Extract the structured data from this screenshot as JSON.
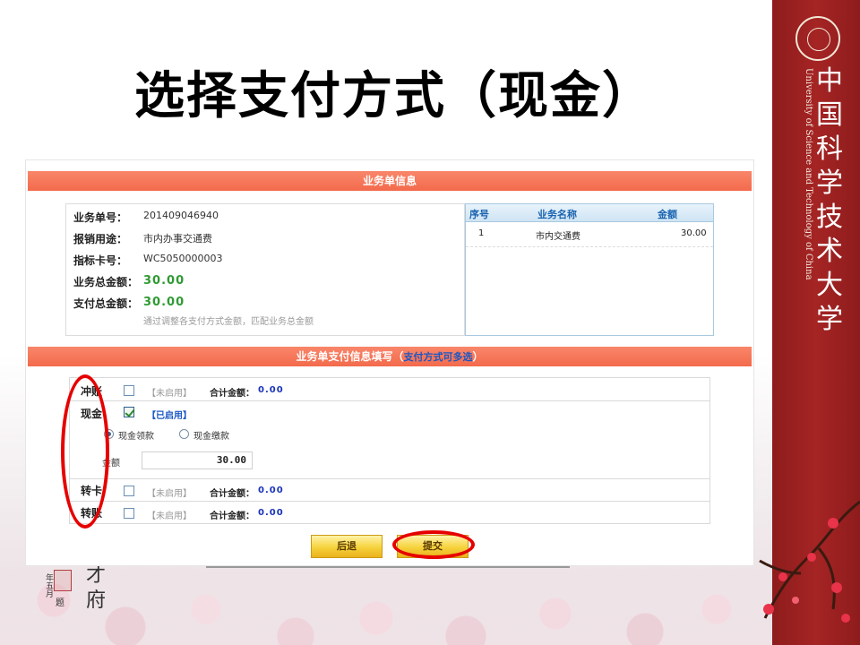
{
  "slide": {
    "title": "选择支付方式（现金）"
  },
  "university": {
    "name_cn": "中国科学技术大学",
    "name_en": "University of Science and Technology of China",
    "calligraphy_right_1": "才",
    "calligraphy_right_2": "府",
    "calligraphy_date": "年五月",
    "calligraphy_sign": "题"
  },
  "business": {
    "section_title": "业务单信息",
    "fields": [
      {
        "label": "业务单号：",
        "value": "201409046940"
      },
      {
        "label": "报销用途：",
        "value": "市内办事交通费"
      },
      {
        "label": "指标卡号：",
        "value": "WC5050000003"
      },
      {
        "label": "业务总金额：",
        "value": "30.00"
      },
      {
        "label": "支付总金额：",
        "value": "30.00"
      }
    ],
    "hint": "通过调整各支付方式金额，匹配业务总金额",
    "table": {
      "headers": [
        "序号",
        "业务名称",
        "金额"
      ],
      "rows": [
        {
          "no": "1",
          "name": "市内交通费",
          "amount": "30.00"
        }
      ]
    }
  },
  "payment": {
    "section_title": "业务单支付信息填写",
    "paren_open": "（",
    "section_note": "支付方式可多选",
    "paren_close": "）",
    "methods": {
      "offset": {
        "label": "冲账",
        "status": "【未启用】",
        "sum_label": "合计金额：",
        "sum_value": "0.00"
      },
      "cash": {
        "label": "现金",
        "status": "【已启用】",
        "checked": true
      },
      "card": {
        "label": "转卡",
        "status": "【未启用】",
        "sum_label": "合计金额：",
        "sum_value": "0.00"
      },
      "transfer": {
        "label": "转账",
        "status": "【未启用】",
        "sum_label": "合计金额：",
        "sum_value": "0.00"
      }
    },
    "cash_options": {
      "receive": "现金领款",
      "pay": "现金缴款",
      "selected": "现金领款"
    },
    "amount_label": "金额",
    "amount_value": "30.00"
  },
  "buttons": {
    "back": "后退",
    "submit": "提交"
  },
  "colors": {
    "section_bar": "#f36a4c",
    "side_band": "#a52424",
    "highlight_ring": "#e60000",
    "amount_green": "#2f9a33",
    "sum_blue": "#1a34b8"
  }
}
